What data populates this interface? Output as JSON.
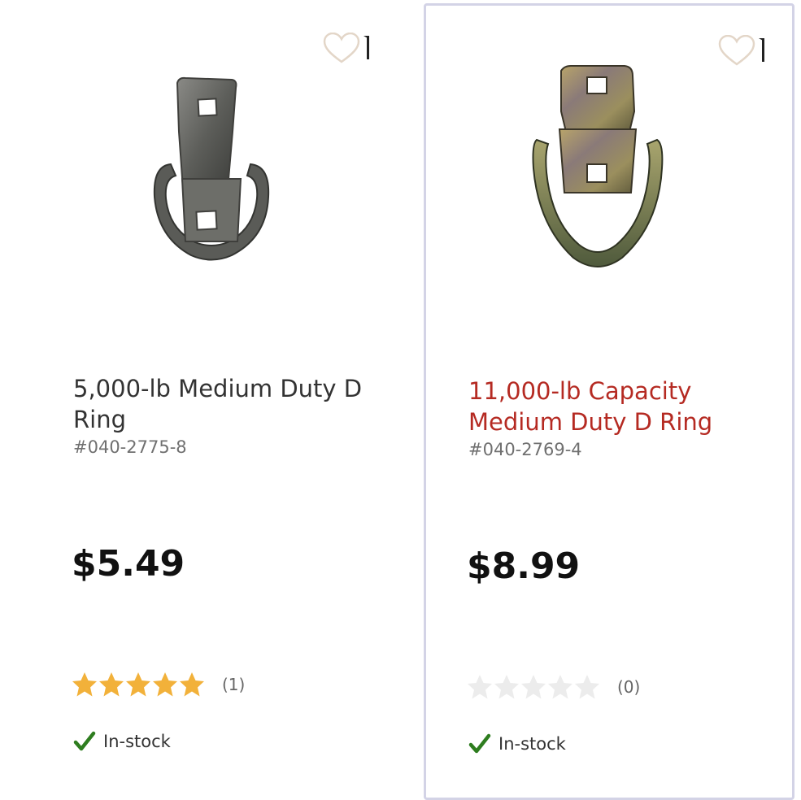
{
  "products": [
    {
      "title": "5,000-lb Medium Duty D Ring",
      "sku": "#040-2775-8",
      "price": "$5.49",
      "rating": 5,
      "review_count": "(1)",
      "stock_status": "In-stock",
      "title_color": "#333333",
      "selected": false,
      "icons": [
        "heart-outline-icon",
        "d-ring-image",
        "star-icon",
        "check-icon"
      ]
    },
    {
      "title": "11,000-lb Capacity Medium Duty D Ring",
      "sku": "#040-2769-4",
      "price": "$8.99",
      "rating": 0,
      "review_count": "(0)",
      "stock_status": "In-stock",
      "title_color": "#b52a22",
      "selected": true,
      "icons": [
        "heart-outline-icon",
        "d-ring-image",
        "star-icon",
        "check-icon"
      ]
    }
  ],
  "colors": {
    "star_filled": "#f2b13a",
    "star_empty": "#ececec",
    "check": "#2e7d1f",
    "selected_border": "#d3d3e6"
  }
}
